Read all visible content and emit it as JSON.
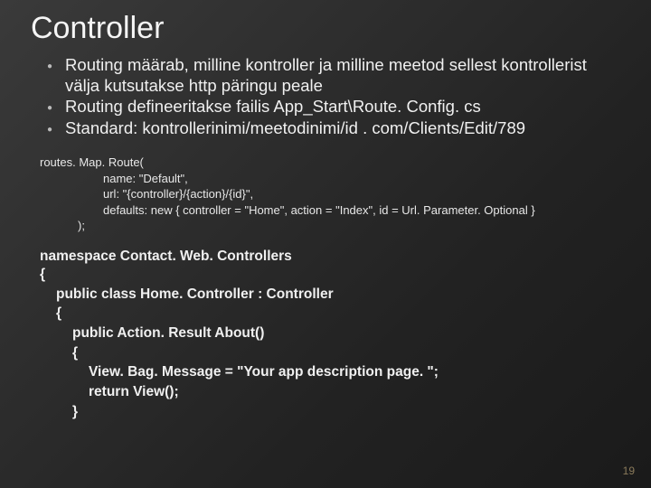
{
  "title": "Controller",
  "bullets": [
    "Routing määrab, milline kontroller ja milline meetod sellest kontrollerist välja kutsutakse http päringu peale",
    "Routing defineeritakse failis App_Start\\Route. Config. cs",
    "Standard: kontrollerinimi/meetodinimi/id . com/Clients/Edit/789"
  ],
  "code_route": {
    "l0": "routes. Map. Route(",
    "l1": "name: \"Default\",",
    "l2": "url: \"{controller}/{action}/{id}\",",
    "l3": "defaults: new { controller = \"Home\", action = \"Index\", id = Url. Parameter. Optional }",
    "l4": ");"
  },
  "code_ns": {
    "l0": "namespace Contact. Web. Controllers",
    "l1": "{",
    "l2": "public class Home. Controller : Controller",
    "l3": "{",
    "l4": "public Action. Result About()",
    "l5": "{",
    "l6": "View. Bag. Message = \"Your app description page. \";",
    "l7": "return View();",
    "l8": "}"
  },
  "page_number": "19"
}
